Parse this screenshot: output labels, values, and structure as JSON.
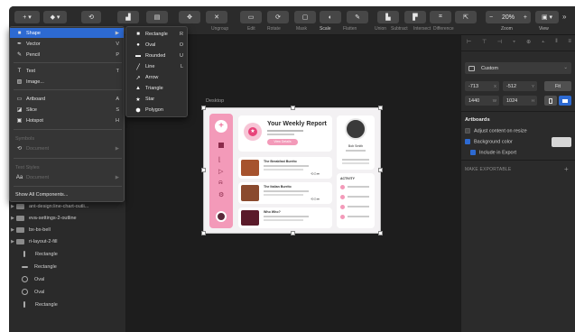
{
  "toolbar": {
    "labels": {
      "ungroup": "Ungroup",
      "edit": "Edit",
      "rotate": "Rotate",
      "mask": "Mask",
      "scale": "Scale",
      "flatten": "Flatten",
      "union": "Union",
      "subtract": "Subtract",
      "intersect": "Intersect",
      "difference": "Difference",
      "zoom": "Zoom",
      "view": "View"
    },
    "zoom_value": "20%",
    "more": "»"
  },
  "insert_menu": {
    "items": [
      {
        "label": "Shape",
        "shortcut": "▶",
        "icon": "shape-icon"
      },
      {
        "label": "Vector",
        "shortcut": "V",
        "icon": "vector-pen-icon"
      },
      {
        "label": "Pencil",
        "shortcut": "P",
        "icon": "pencil-icon"
      },
      {
        "label": "Text",
        "shortcut": "T",
        "icon": "text-icon"
      },
      {
        "label": "Image...",
        "shortcut": "",
        "icon": "image-icon"
      },
      {
        "label": "Artboard",
        "shortcut": "A",
        "icon": "artboard-icon"
      },
      {
        "label": "Slice",
        "shortcut": "S",
        "icon": "slice-icon"
      },
      {
        "label": "Hotspot",
        "shortcut": "H",
        "icon": "hotspot-icon"
      },
      {
        "label": "Symbols",
        "shortcut": "",
        "icon": ""
      },
      {
        "label": "Document",
        "shortcut": "▶",
        "icon": "symbol-icon"
      },
      {
        "label": "Text Styles",
        "shortcut": "",
        "icon": ""
      },
      {
        "label": "Document",
        "shortcut": "▶",
        "icon": "text-style-icon"
      },
      {
        "label": "Show All Components...",
        "shortcut": "",
        "icon": ""
      }
    ]
  },
  "shape_submenu": {
    "items": [
      {
        "label": "Rectangle",
        "shortcut": "R",
        "icon": "rectangle-icon"
      },
      {
        "label": "Oval",
        "shortcut": "O",
        "icon": "oval-icon"
      },
      {
        "label": "Rounded",
        "shortcut": "U",
        "icon": "rounded-rect-icon"
      },
      {
        "label": "Line",
        "shortcut": "L",
        "icon": "line-icon"
      },
      {
        "label": "Arrow",
        "shortcut": "",
        "icon": "arrow-icon"
      },
      {
        "label": "Triangle",
        "shortcut": "",
        "icon": "triangle-icon"
      },
      {
        "label": "Star",
        "shortcut": "",
        "icon": "star-icon"
      },
      {
        "label": "Polygon",
        "shortcut": "",
        "icon": "polygon-icon"
      }
    ]
  },
  "layers": [
    {
      "label": "ant-design:line-chart-outli...",
      "group": true
    },
    {
      "label": "eva-settings-2-outline",
      "group": true
    },
    {
      "label": "bx-bx-bell",
      "group": true
    },
    {
      "label": "ri-layout-2-fill",
      "group": true
    },
    {
      "label": "Rectangle",
      "group": false,
      "icon": "rectangle-layer-icon"
    },
    {
      "label": "Rectangle",
      "group": false,
      "icon": "line-layer-icon"
    },
    {
      "label": "Oval",
      "group": false,
      "icon": "oval-layer-icon"
    },
    {
      "label": "Oval",
      "group": false,
      "icon": "oval-layer-icon"
    },
    {
      "label": "Rectangle",
      "group": false,
      "icon": "vertical-rect-layer-icon"
    }
  ],
  "canvas": {
    "artboard_name": "Desktop",
    "report": {
      "title": "Your Weekly Report",
      "button": "View Details"
    },
    "profile": {
      "name": "Bob Smith"
    },
    "recipes": [
      {
        "title": "The Breakfast Burrito"
      },
      {
        "title": "The Italian Burrito"
      },
      {
        "title": "Who Who?"
      }
    ],
    "activity_label": "ACTIVITY"
  },
  "inspector": {
    "preset": "Custom",
    "x": "-713",
    "y": "-512",
    "fit": "Fit",
    "width": "1440",
    "height": "1024",
    "section_artboards": "Artboards",
    "adjust_content": "Adjust content on resize",
    "background_color": "Background color",
    "include_export": "Include in Export",
    "make_exportable": "MAKE EXPORTABLE",
    "add": "+"
  },
  "colors": {
    "accent": "#2d6ad2",
    "pink": "#e8437a"
  }
}
